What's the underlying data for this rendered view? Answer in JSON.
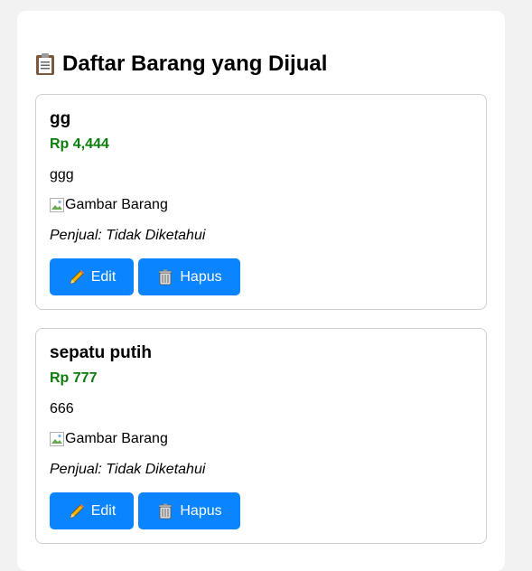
{
  "page": {
    "title": "Daftar Barang yang Dijual",
    "title_icon": "clipboard-icon"
  },
  "items": [
    {
      "name": "gg",
      "price": "Rp 4,444",
      "description": "ggg",
      "image_alt": "Gambar Barang",
      "seller": "Penjual: Tidak Diketahui",
      "edit_label": "Edit",
      "delete_label": "Hapus"
    },
    {
      "name": "sepatu putih",
      "price": "Rp 777",
      "description": "666",
      "image_alt": "Gambar Barang",
      "seller": "Penjual: Tidak Diketahui",
      "edit_label": "Edit",
      "delete_label": "Hapus"
    }
  ],
  "colors": {
    "price": "#0a7d0a",
    "button": "#0a84ff",
    "page_bg": "#f2f2f2",
    "card_border": "#cfcfcf"
  },
  "icons": {
    "edit": "pencil-icon",
    "delete": "trash-icon",
    "image": "broken-image-icon"
  }
}
